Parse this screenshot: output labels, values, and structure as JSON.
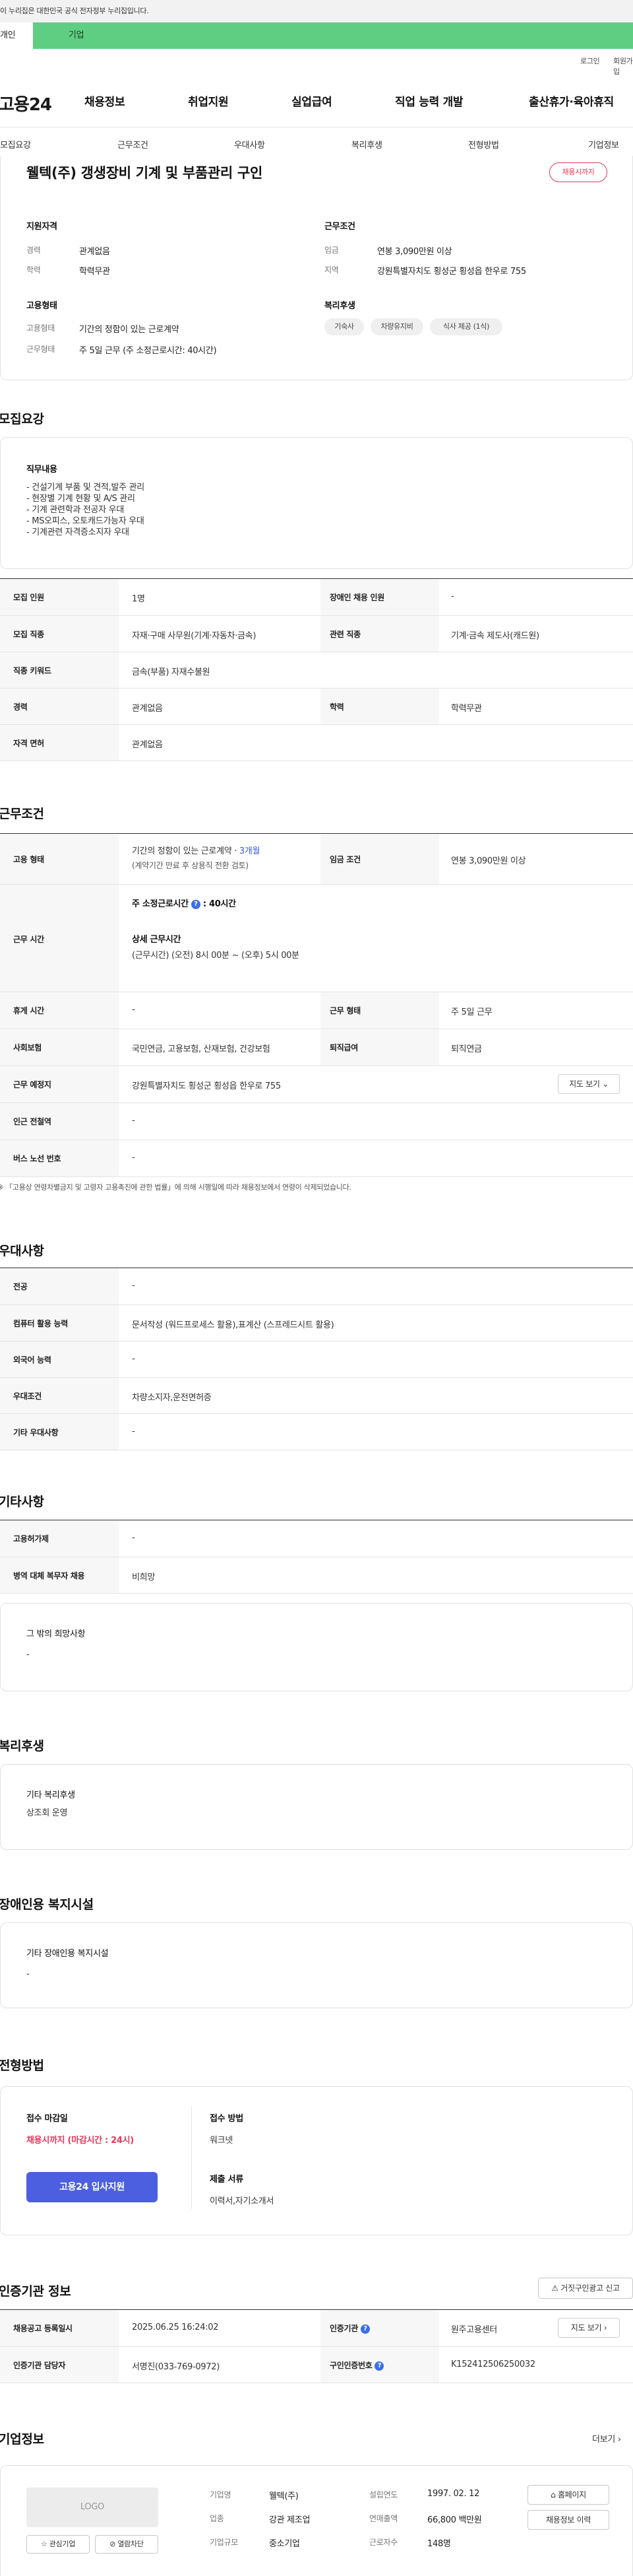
{
  "gov_notice": "이 누리집은 대한민국 공식 전자정부 누리집입니다.",
  "tabs": {
    "individual": "개인",
    "corporate": "기업"
  },
  "util": {
    "login": "로그인",
    "signup": "회원가입"
  },
  "site": {
    "logo": "고용24"
  },
  "gnb": [
    "채용정보",
    "취업지원",
    "실업급여",
    "직업 능력 개발",
    "출산휴가·육아휴직"
  ],
  "subnav": [
    "모집요강",
    "근무조건",
    "우대사항",
    "복리후생",
    "전형방법",
    "기업정보"
  ],
  "job": {
    "title": "웰텍(주) 갱생장비 기계 및 부품관리 구인",
    "deadline_badge": "채용시까지"
  },
  "summary": {
    "qualification_title": "지원자격",
    "career_label": "경력",
    "career_value": "관계없음",
    "education_label": "학력",
    "education_value": "학력무관",
    "employment_title": "고용형태",
    "emp_type_label": "고용형태",
    "emp_type_value": "기간의 정함이 있는 근로계약",
    "work_form_label": "근무형태",
    "work_form_value": "주 5일 근무 (주 소정근로시간: 40시간)",
    "condition_title": "근무조건",
    "wage_label": "임금",
    "wage_value": "연봉 3,090만원 이상",
    "region_label": "지역",
    "region_value": "강원특별자치도 횡성군 횡성읍 한우로 755",
    "welfare_title": "복리후생",
    "welfare_chips": [
      "기숙사",
      "차량유지비",
      "식사 제공 (1식)"
    ]
  },
  "recruit": {
    "heading": "모집요강",
    "duty_title": "직무내용",
    "duty_lines": [
      "- 건설기계 부품 및 견적,발주 관리",
      "- 현장별 기계 현황 및 A/S 관리",
      "- 기계 관련학과 전공자 우대",
      "- MS오피스, 오토캐드가능자 우대",
      "- 기계관련 자격증소지자 우대"
    ],
    "rows": {
      "headcount_label": "모집 인원",
      "headcount_value": "1명",
      "disabled_label": "장애인 채용 인원",
      "disabled_value": "-",
      "occupation_label": "모집 직종",
      "occupation_value": "자재·구매 사무원(기계·자동차·금속)",
      "related_label": "관련 직종",
      "related_value": "기계·금속 제도사(캐드원)",
      "keyword_label": "직종 키워드",
      "keyword_value": "금속(부품) 자재수불원",
      "career_label": "경력",
      "career_value": "관계없음",
      "edu_label": "학력",
      "edu_value": "학력무관",
      "license_label": "자격 면허",
      "license_value": "관계없음"
    }
  },
  "conditions": {
    "heading": "근무조건",
    "emp_label": "고용 형태",
    "emp_value_a": "기간의 정함이 있는 근로계약 · ",
    "emp_period": "3개월",
    "emp_value_b": "(계약기간 만료 후 상용직 전환 검토)",
    "wage_label": "임금 조건",
    "wage_value": "연봉 3,090만원 이상",
    "hours_label": "근무 시간",
    "hours_weekly_a": "주 소정근로시간",
    "hours_weekly_b": ": 40시간",
    "hours_detail_title": "상세 근무시간",
    "hours_detail": "(근무시간) (오전) 8시 00분 ~ (오후) 5시 00분",
    "holiday_label": "휴게 시간",
    "holiday_value": "-",
    "workform_label": "근무 형태",
    "workform_value": "주 5일 근무",
    "insurance_label": "사회보험",
    "insurance_value": "국민연금, 고용보험, 산재보험, 건강보험",
    "severance_label": "퇴직급여",
    "severance_value": "퇴직연금",
    "location_label": "근무 예정지",
    "location_value": "강원특별자치도 횡성군 횡성읍 한우로 755",
    "map_btn": "지도 보기",
    "station_label": "인근 전철역",
    "station_value": "-",
    "bus_label": "버스 노선 번호",
    "bus_value": "-",
    "footnote": "※ 「고용상 연령차별금지 및 고령자 고용촉진에 관한 법률」에 의해 시행일에 따라 채용정보에서 연령이 삭제되었습니다."
  },
  "preference": {
    "heading": "우대사항",
    "major_label": "전공",
    "major_value": "-",
    "computer_label": "컴퓨터 활용 능력",
    "computer_value": "문서작성 (워드프로세스 활용),표계산 (스프레드시트 활용)",
    "language_label": "외국어 능력",
    "language_value": "-",
    "pref_label": "우대조건",
    "pref_value": "차량소지자,운전면허증",
    "etc_label": "기타 우대사항",
    "etc_value": "-"
  },
  "etc": {
    "heading": "기타사항",
    "form_label": "고용허가제",
    "form_value": "-",
    "military_label": "병역 대체 복무자 채용",
    "military_value": "비희망",
    "other_title": "그 밖의 희망사항",
    "other_value": "-"
  },
  "welfare": {
    "heading": "복리후생",
    "title": "기타 복리후생",
    "value": "상조회 운영"
  },
  "disabled_facility": {
    "heading": "장애인용 복지시설",
    "title": "기타 장애인용 복지시설",
    "value": "-"
  },
  "selection": {
    "heading": "전형방법",
    "deadline_title": "접수 마감일",
    "deadline_value": "채용시까지 (마감시간 : 24시)",
    "apply_btn": "고용24 입사지원",
    "method_title": "접수 방법",
    "method_value": "워크넷",
    "docs_title": "제출 서류",
    "docs_value": "이력서,자기소개서"
  },
  "agency": {
    "heading": "인증기관 정보",
    "report_btn": "거짓구인광고 신고",
    "reg_label": "채용공고 등록일시",
    "reg_value": "2025.06.25 16:24:02",
    "agency_label": "인증기관",
    "agency_value": "원주고용센터",
    "detail_btn": "지도 보기",
    "manager_label": "인증기관 담당자",
    "manager_value": "서명진(033-769-0972)",
    "cert_label": "구인인증번호",
    "cert_value": "K152412506250032"
  },
  "company": {
    "heading": "기업정보",
    "more": "더보기",
    "logo_placeholder": "LOGO",
    "interest_btn": "관심기업",
    "view_btn": "열람차단",
    "name_label": "기업명",
    "name_value": "웰텍(주)",
    "industry_label": "업종",
    "industry_value": "강관 제조업",
    "size_label": "기업규모",
    "size_value": "중소기업",
    "founded_label": "설립연도",
    "founded_value": "1997. 02. 12",
    "sales_label": "연매출액",
    "sales_value": "66,800 백만원",
    "employees_label": "근로자수",
    "employees_value": "148명",
    "homepage_btn": "홈페이지",
    "history_btn": "채용정보 이력"
  },
  "colors": {
    "accent_green": "#5fce82",
    "primary_blue": "#4c5fe0",
    "deadline_red": "#e5375a"
  }
}
